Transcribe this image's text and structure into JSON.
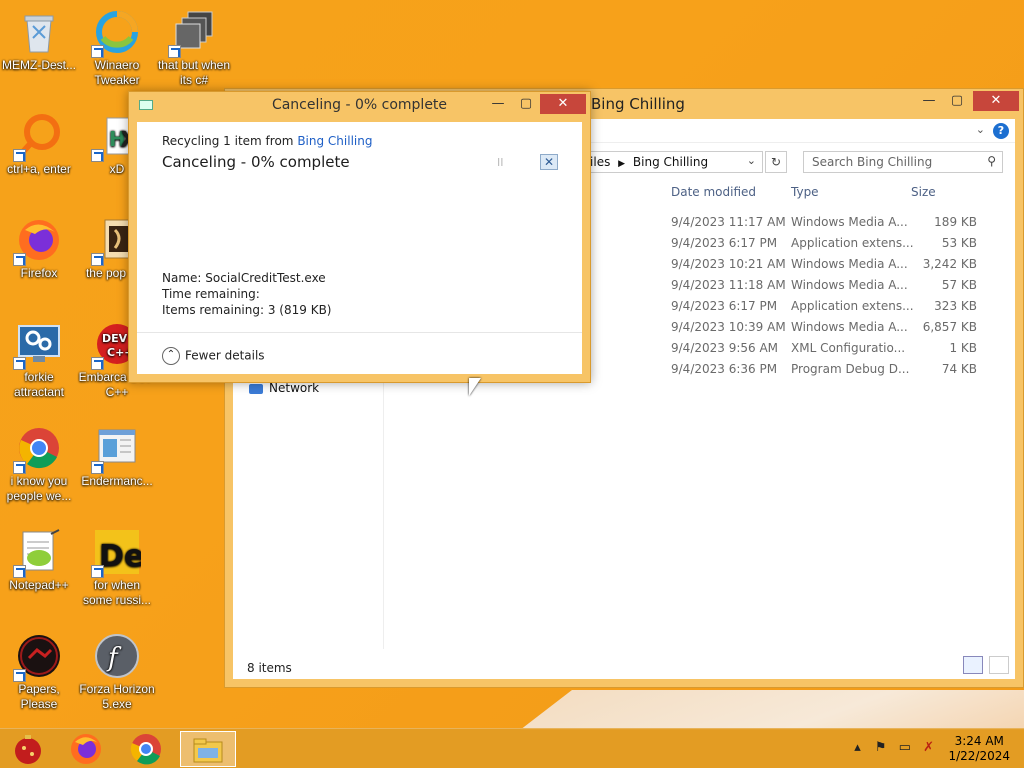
{
  "desktop": {
    "icons": [
      {
        "label": "MEMZ-Dest...",
        "icon": "recycle-bin-icon"
      },
      {
        "label": "Winaero Tweaker",
        "icon": "winaero-tweaker-icon"
      },
      {
        "label": "that but when its c#",
        "icon": "stacked-windows-icon"
      },
      {
        "label": "ctrl+a, enter",
        "icon": "orange-search-icon"
      },
      {
        "label": "xD",
        "icon": "hx-icon"
      },
      {
        "label": "Firefox",
        "icon": "firefox-icon"
      },
      {
        "label": "the pop shit",
        "icon": "media-file-icon"
      },
      {
        "label": "forkie attractant",
        "icon": "settings-monitor-icon"
      },
      {
        "label": "Embarca Dev-C++",
        "icon": "devcpp-icon"
      },
      {
        "label": "i know you people we...",
        "icon": "chrome-icon"
      },
      {
        "label": "Endermanc...",
        "icon": "document-window-icon"
      },
      {
        "label": "Notepad++",
        "icon": "notepadpp-icon"
      },
      {
        "label": "for when some russi...",
        "icon": "de-icon"
      },
      {
        "label": "Papers, Please",
        "icon": "papers-please-icon"
      },
      {
        "label": "Forza Horizon 5.exe",
        "icon": "flash-icon"
      }
    ]
  },
  "explorer": {
    "title": "Bing Chilling",
    "minimize": "—",
    "maximize": "▢",
    "close": "✕",
    "help": "?",
    "breadcrumb": [
      "Files",
      "Bing Chilling"
    ],
    "search_placeholder": "Search Bing Chilling",
    "columns": {
      "date": "Date modified",
      "type": "Type",
      "size": "Size"
    },
    "files": [
      {
        "date": "9/4/2023 11:17 AM",
        "type": "Windows Media A...",
        "size": "189 KB"
      },
      {
        "date": "9/4/2023 6:17 PM",
        "type": "Application extens...",
        "size": "53 KB"
      },
      {
        "date": "9/4/2023 10:21 AM",
        "type": "Windows Media A...",
        "size": "3,242 KB"
      },
      {
        "date": "9/4/2023 11:18 AM",
        "type": "Windows Media A...",
        "size": "57 KB"
      },
      {
        "date": "9/4/2023 6:17 PM",
        "type": "Application extens...",
        "size": "323 KB"
      },
      {
        "date": "9/4/2023 10:39 AM",
        "type": "Windows Media A...",
        "size": "6,857 KB"
      },
      {
        "date": "9/4/2023 9:56 AM",
        "type": "XML Configuratio...",
        "size": "1 KB"
      },
      {
        "date": "9/4/2023 6:36 PM",
        "type": "Program Debug D...",
        "size": "74 KB"
      }
    ],
    "nav_network": "Network",
    "status": "8 items"
  },
  "dialog": {
    "title": "Canceling - 0% complete",
    "minimize": "—",
    "maximize": "▢",
    "close": "✕",
    "from_prefix": "Recycling 1 item from",
    "from_link": "Bing Chilling",
    "heading": "Canceling - 0% complete",
    "pause": "II",
    "stop": "✕",
    "name_label": "Name:",
    "name_value": "SocialCreditTest.exe",
    "time_label": "Time remaining:",
    "items_label": "Items remaining:",
    "items_value": "3 (819 KB)",
    "fewer_details": "Fewer details"
  },
  "taskbar": {
    "items": [
      "ornament-icon",
      "firefox-icon",
      "chrome-icon",
      "file-explorer-icon"
    ],
    "time": "3:24 AM",
    "date": "1/22/2024"
  },
  "colors": {
    "accent": "#f7c466",
    "desktop": "#f6a21a",
    "link": "#1e5fc6",
    "close_button": "#c7463b"
  }
}
